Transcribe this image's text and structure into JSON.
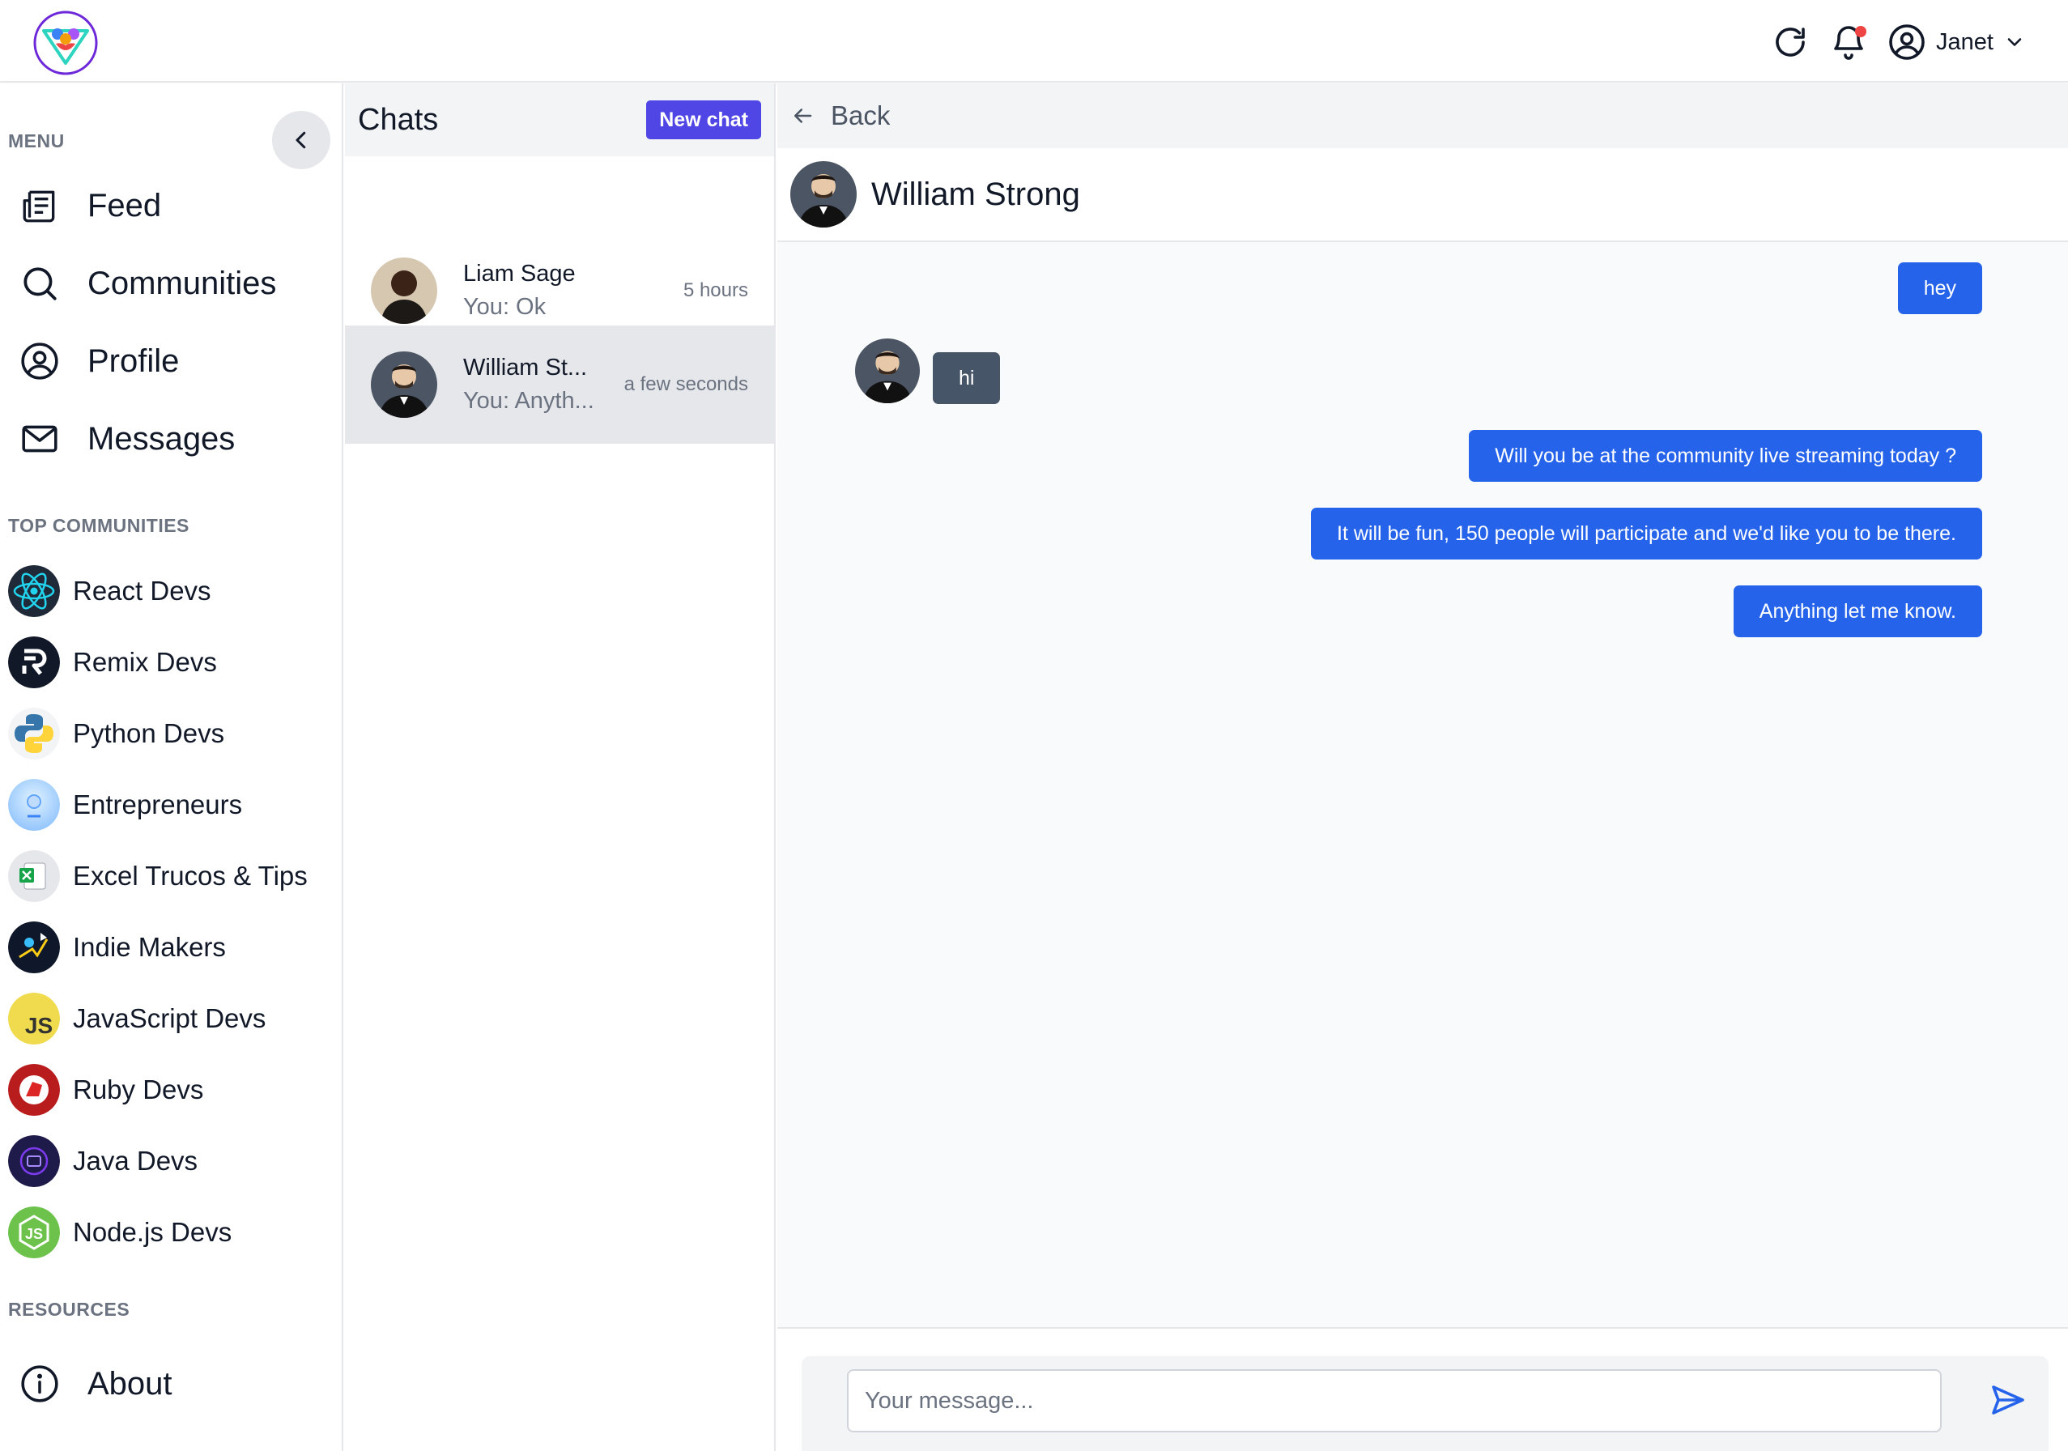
{
  "user": {
    "name": "Janet"
  },
  "sidebar": {
    "menu_heading": "MENU",
    "nav": [
      {
        "label": "Feed",
        "icon": "newspaper-icon"
      },
      {
        "label": "Communities",
        "icon": "search-icon"
      },
      {
        "label": "Profile",
        "icon": "user-circle-icon"
      },
      {
        "label": "Messages",
        "icon": "envelope-icon"
      }
    ],
    "communities_heading": "TOP COMMUNITIES",
    "communities": [
      {
        "label": "React Devs"
      },
      {
        "label": "Remix Devs"
      },
      {
        "label": "Python Devs"
      },
      {
        "label": "Entrepreneurs"
      },
      {
        "label": "Excel Trucos & Tips"
      },
      {
        "label": "Indie Makers"
      },
      {
        "label": "JavaScript Devs"
      },
      {
        "label": "Ruby Devs"
      },
      {
        "label": "Java Devs"
      },
      {
        "label": "Node.js Devs"
      }
    ],
    "resources_heading": "RESOURCES",
    "resources": [
      {
        "label": "About",
        "icon": "info-icon"
      }
    ]
  },
  "chats": {
    "title": "Chats",
    "new_chat_label": "New chat",
    "items": [
      {
        "name": "Liam Sage",
        "preview": "You: Ok",
        "time": "5 hours",
        "active": false
      },
      {
        "name": "William St...",
        "preview": "You: Anyth...",
        "time": "a few seconds",
        "active": true
      }
    ]
  },
  "conversation": {
    "back_label": "Back",
    "contact_name": "William Strong",
    "messages": [
      {
        "from": "me",
        "text": "hey"
      },
      {
        "from": "them",
        "text": "hi"
      },
      {
        "from": "me",
        "text": "Will you be at the community live streaming today ?"
      },
      {
        "from": "me",
        "text": "It will be fun, 150 people will participate and we'd like you to be there."
      },
      {
        "from": "me",
        "text": "Anything let me know."
      }
    ],
    "input_placeholder": "Your message..."
  },
  "colors": {
    "accent_indigo": "#4f46e5",
    "bubble_outgoing": "#2563eb",
    "bubble_incoming": "#475569",
    "notification_dot": "#ef4444"
  }
}
